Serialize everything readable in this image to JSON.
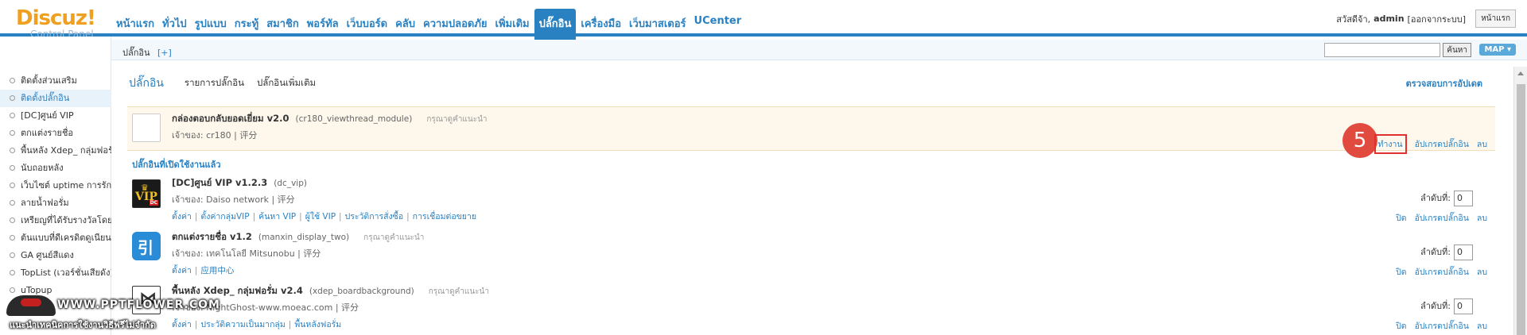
{
  "logo": {
    "main": "Discuz!",
    "sub": "Control Panel"
  },
  "topnav": {
    "items": [
      "หน้าแรก",
      "ทั่วไป",
      "รูปแบบ",
      "กระทู้",
      "สมาชิก",
      "พอร์ทัล",
      "เว็บบอร์ด",
      "คลับ",
      "ความปลอดภัย",
      "เพิ่มเติม",
      "ปลั๊กอิน",
      "เครื่องมือ",
      "เว็บมาสเตอร์",
      "UCenter"
    ],
    "active_index": 10
  },
  "user": {
    "greeting": "สวัสดีจ้า,",
    "username": "admin",
    "logout": "[ออกจากระบบ]",
    "home_button": "หน้าแรก"
  },
  "subheader": {
    "crumb": "ปลั๊กอิน",
    "add": "[+]",
    "search_button": "ค้นหา",
    "map_button": "MAP ▾"
  },
  "sidebar": {
    "items": [
      "ติดตั้งส่วนเสริม",
      "ติดตั้งปลั๊กอิน",
      "[DC]ศูนย์ VIP",
      "ตกแต่งรายชื่อ",
      "พื้นหลัง Xdep_ กลุ่มฟอรั่ม",
      "นับถอยหลัง",
      "เว็บไซต์ uptime การรักษา",
      "ลายน้ำฟอรั่ม",
      "เหรียญที่ได้รับรางวัลโดยอัตโนมัติ",
      "ต้นแบบที่ดีเครดิตดูเนียน",
      "GA ศูนย์สีแดง",
      "TopList (เวอร์ชั่นเสียดัง)",
      "uTopup"
    ],
    "active_index": 1
  },
  "main": {
    "title": "ปลั๊กอิน",
    "tabs": [
      "รายการปลั๊กอิน",
      "ปลั๊กอินเพิ่มเติม"
    ],
    "check_update": "ตรวจสอบการอัปเดต",
    "pending": {
      "name": "กล่องตอบกลับยอดเยี่ยม v2.0",
      "ident": "(cr180_viewthread_module)",
      "recommend": "กรุณาดูคำแนะนำ",
      "author": "เจ้าของ: cr180 | 评分",
      "actions": [
        "ทำงาน",
        "อัปเกรดปลั๊กอิน",
        "ลบ"
      ],
      "step": "5"
    },
    "section_title": "ปลั๊กอินที่เปิดใช้งานแล้ว",
    "order_label": "ลำดับที่:",
    "plugins": [
      {
        "name": "[DC]ศูนย์ VIP v1.2.3",
        "ident": "(dc_vip)",
        "recommend": "",
        "author": "เจ้าของ: Daiso network | 评分",
        "links": [
          "ตั้งค่า",
          "ตั้งค่ากลุ่มVIP",
          "ค้นหา VIP",
          "ผู้ใช้ VIP",
          "ประวัติการสั่งซื้อ",
          "การเชื่อมต่อขยาย"
        ],
        "actions": [
          "ปิด",
          "อัปเกรดปลั๊กอิน",
          "ลบ"
        ],
        "order": "0",
        "icon": "vip-icon"
      },
      {
        "name": "ตกแต่งรายชื่อ v1.2",
        "ident": "(manxin_display_two)",
        "recommend": "กรุณาดูคำแนะนำ",
        "author": "เจ้าของ: เทคโนโลยี Mitsunobu | 评分",
        "links": [
          "ตั้งค่า",
          "应用中心"
        ],
        "actions": [
          "ปิด",
          "อัปเกรดปลั๊กอิน",
          "ลบ"
        ],
        "order": "0",
        "icon": "display-icon"
      },
      {
        "name": "พื้นหลัง Xdep_ กลุ่มฟอรั่ม v2.4",
        "ident": "(xdep_boardbackground)",
        "recommend": "กรุณาดูคำแนะนำ",
        "author": "เจ้าของ: NightGhost-www.moeac.com | 评分",
        "links": [
          "ตั้งค่า",
          "ประวัติความเป็นมากลุ่ม",
          "พื้นหลังฟอรั่ม"
        ],
        "actions": [
          "ปิด",
          "อัปเกรดปลั๊กอิน",
          "ลบ"
        ],
        "order": "0",
        "icon": "xdep-icon"
      }
    ]
  },
  "watermark": {
    "url": "WWW.PPTFLOWER.COM",
    "caption": "แนะนำเทคนิคการใช้งานวิธีฟรีไม่จำกัด"
  },
  "colors": {
    "accent": "#2a81c2",
    "highlight_row": "#fef8ec",
    "step_badge": "#e14a3e",
    "logo": "#f0a020"
  }
}
